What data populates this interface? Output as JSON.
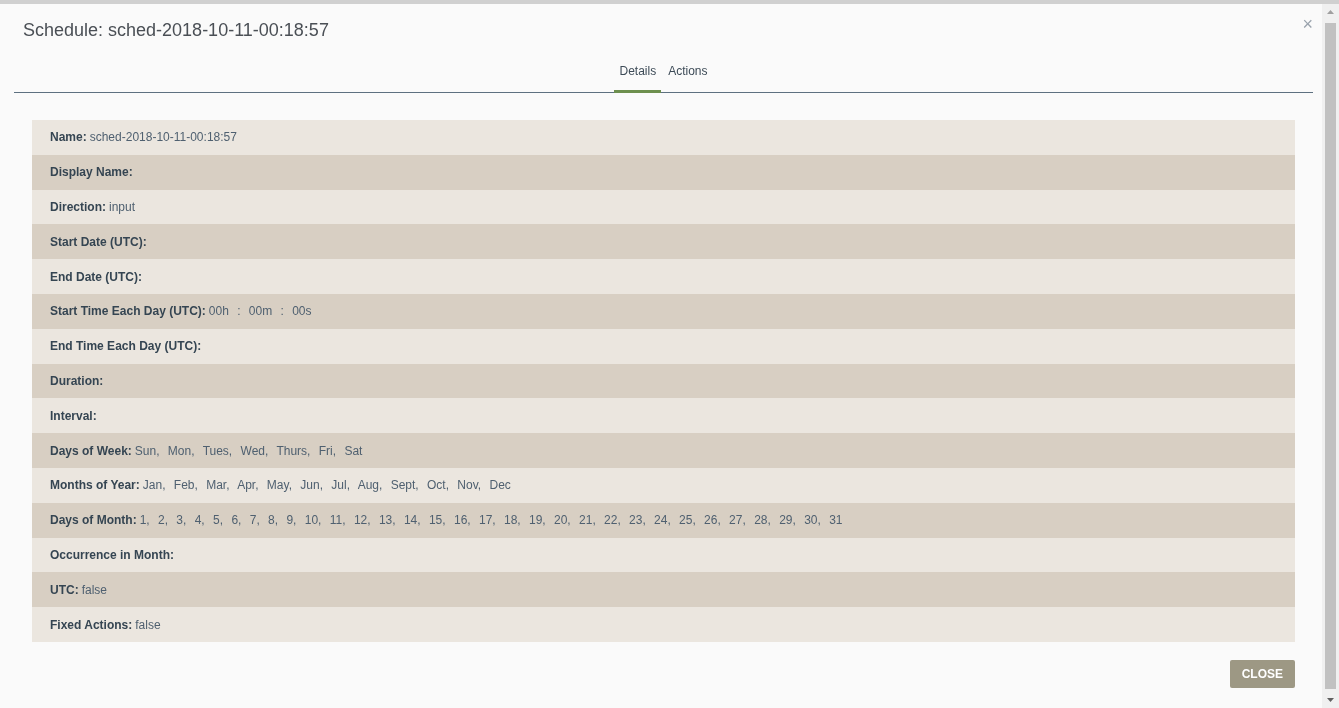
{
  "dialog": {
    "title": "Schedule: sched-2018-10-11-00:18:57",
    "close_icon": "×"
  },
  "tabs": [
    {
      "label": "Details",
      "selected": true
    },
    {
      "label": "Actions",
      "selected": false
    }
  ],
  "details": [
    {
      "label": "Name:",
      "value": "sched-2018-10-11-00:18:57"
    },
    {
      "label": "Display Name:"
    },
    {
      "label": "Direction:",
      "value": "input"
    },
    {
      "label": "Start Date (UTC):"
    },
    {
      "label": "End Date (UTC):"
    },
    {
      "label": "Start Time Each Day (UTC):",
      "value": "00h : 00m : 00s"
    },
    {
      "label": "End Time Each Day (UTC):"
    },
    {
      "label": "Duration:"
    },
    {
      "label": "Interval:"
    },
    {
      "label": "Days of Week:",
      "value": "Sun, Mon, Tues, Wed, Thurs, Fri, Sat"
    },
    {
      "label": "Months of Year:",
      "value": "Jan, Feb, Mar, Apr, May, Jun, Jul, Aug, Sept, Oct, Nov, Dec"
    },
    {
      "label": "Days of Month:",
      "value": "1, 2, 3, 4, 5, 6, 7, 8, 9, 10, 11, 12, 13, 14, 15, 16, 17, 18, 19, 20, 21, 22, 23, 24, 25, 26, 27, 28, 29, 30, 31"
    },
    {
      "label": "Occurrence in Month:"
    },
    {
      "label": "UTC:",
      "value": "false"
    },
    {
      "label": "Fixed Actions:",
      "value": "false"
    }
  ],
  "footer": {
    "button": "CLOSE"
  }
}
